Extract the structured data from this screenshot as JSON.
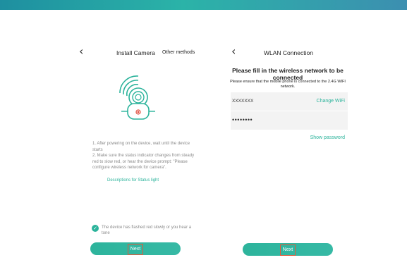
{
  "install": {
    "back_icon": "chevron-left-icon",
    "title": "Install Camera",
    "other_methods": "Other methods",
    "instruction_1": "1. After powering on the device, wait until the device starts",
    "instruction_2": "2. Make sure the status indicator changes from steady red to slow red, or hear the device prompt: \"Please configure wireless network for camera\".",
    "status_link": "Descriptions for Status light",
    "confirm_text": "The device has flashed red slowly or you hear a tone",
    "confirm_checked": true,
    "next_label": "Next"
  },
  "wlan": {
    "back_icon": "chevron-left-icon",
    "title": "WLAN Connection",
    "fill_title": "Please fill in the wireless network to be connected",
    "ensure_text": "Please ensure that the mobile phone is connected to the 2.4G WIFI network.",
    "ssid_value": "XXXXXXX",
    "change_wifi": "Change WiFi",
    "password_value": "••••••••",
    "show_password": "Show password",
    "next_label": "Next"
  },
  "colors": {
    "accent": "#2bb39b",
    "highlight_border": "#e05a3c",
    "indicator_red": "#e04a3a"
  }
}
